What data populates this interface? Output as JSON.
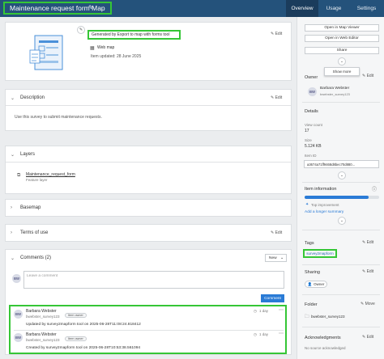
{
  "header": {
    "title": "Maintenance request form Map",
    "tabs": [
      {
        "label": "Overview",
        "active": true
      },
      {
        "label": "Usage",
        "active": false
      },
      {
        "label": "Settings",
        "active": false
      }
    ]
  },
  "summary": {
    "generated": "Generated by Export to map with forms tool",
    "edit": "Edit",
    "item_type": "Web map",
    "updated": "Item updated: 28 June 2025"
  },
  "description": {
    "heading": "Description",
    "text": "Use this survey to submit maintenance requests.",
    "edit": "Edit"
  },
  "layers": {
    "heading": "Layers",
    "items": [
      {
        "name": "Maintenance_request_form",
        "type": "Feature layer"
      }
    ]
  },
  "basemap": {
    "heading": "Basemap"
  },
  "terms": {
    "heading": "Terms of use",
    "edit": "Edit"
  },
  "comments": {
    "heading": "Comments (2)",
    "sort": "New",
    "placeholder": "Leave a comment",
    "submit": "Comment",
    "avatar": "BW",
    "items": [
      {
        "author": "Barbara Webster",
        "username": "bwebster_survey123",
        "badge": "Item owner",
        "time": "1 day",
        "text": "Updated by survey2mapform tool on 2025-06-28T11:08:24.818412",
        "avatar": "BW"
      },
      {
        "author": "Barbara Webster",
        "username": "bwebster_survey123",
        "badge": "Item owner",
        "time": "1 day",
        "text": "Created by survey2mapform tool on 2025-06-28T10:53:38.561094",
        "avatar": "BW"
      }
    ]
  },
  "sidebar": {
    "open_viewer": "Open in Map Viewer",
    "open_editor": "Open in Web Editor",
    "share": "Share",
    "show_more": "Show more",
    "owner_heading": "Owner",
    "owner_name": "Barbara Webster",
    "owner_username": "bwebster_survey123",
    "owner_avatar": "BW",
    "edit": "Edit",
    "details_heading": "Details",
    "view_count_label": "View count",
    "view_count": "17",
    "size_label": "Size",
    "size": "5.124 KB",
    "item_id_label": "Item ID",
    "item_id": "a3674a71ff9468d8bec70d880...",
    "item_info_heading": "Item information",
    "item_info_status": "Top improvement",
    "item_info_progress": 0.86,
    "add_summary": "Add a longer summary",
    "tags_heading": "Tags",
    "tag": "survey2mapform",
    "sharing_heading": "Sharing",
    "sharing_value": "Owner",
    "folder_heading": "Folder",
    "folder_value": "bwebster_survey123",
    "move": "Move",
    "ack_heading": "Acknowledgments",
    "ack_value": "No source acknowledged",
    "accent": "#24527b",
    "highlight": "#35c636",
    "progress_color": "#2a7bd6"
  }
}
